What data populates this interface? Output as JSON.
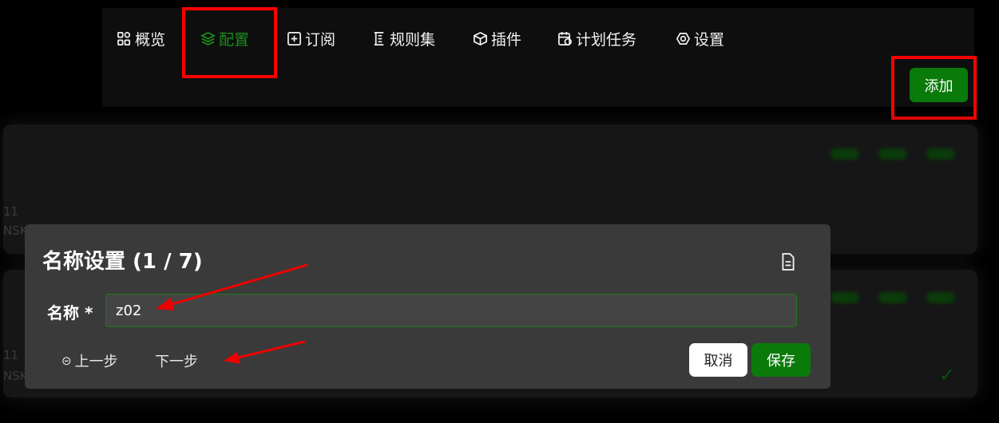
{
  "nav": {
    "items": [
      {
        "label": "概览",
        "icon": "grid-icon"
      },
      {
        "label": "配置",
        "icon": "layers-icon",
        "active": true
      },
      {
        "label": "订阅",
        "icon": "subscription-icon"
      },
      {
        "label": "规则集",
        "icon": "ruleset-icon"
      },
      {
        "label": "插件",
        "icon": "cube-icon"
      },
      {
        "label": "计划任务",
        "icon": "calendar-icon"
      },
      {
        "label": "设置",
        "icon": "gear-icon"
      }
    ],
    "add_label": "添加"
  },
  "background_cards": {
    "faint_text": [
      "11",
      "NSK",
      "11",
      "NSK"
    ]
  },
  "modal": {
    "title": "名称设置 (1 / 7)",
    "field_label": "名称 *",
    "name_value": "z02",
    "prev_label": "上一步",
    "next_label": "下一步",
    "cancel_label": "取消",
    "save_label": "保存"
  },
  "colors": {
    "accent": "#0a7a0a",
    "active_nav": "#1a8f1a",
    "highlight": "#ff0000",
    "modal_bg": "#3a3a3a"
  }
}
